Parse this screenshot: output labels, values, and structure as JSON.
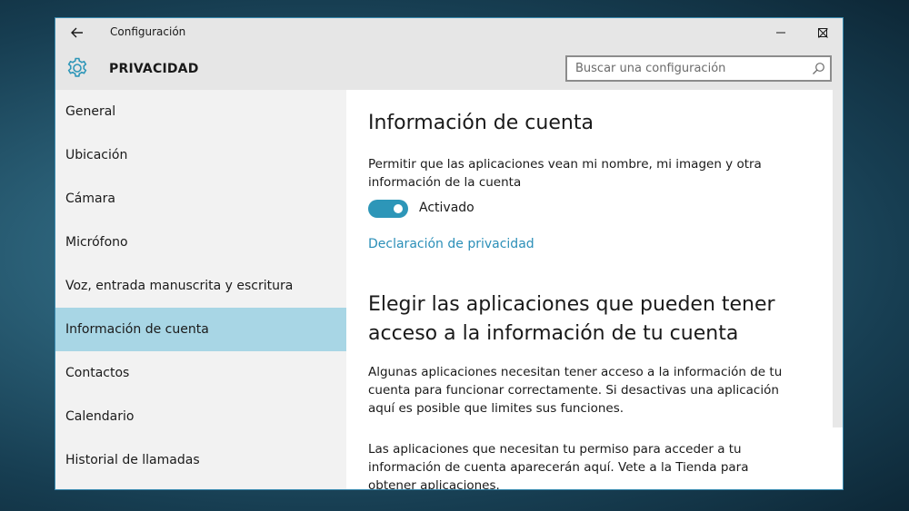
{
  "window": {
    "title": "Configuración"
  },
  "header": {
    "section_title": "PRIVACIDAD",
    "section_icon": "gear-icon",
    "search_placeholder": "Buscar una configuración"
  },
  "sidebar": {
    "items": [
      {
        "label": "General",
        "selected": false
      },
      {
        "label": "Ubicación",
        "selected": false
      },
      {
        "label": "Cámara",
        "selected": false
      },
      {
        "label": "Micrófono",
        "selected": false
      },
      {
        "label": "Voz, entrada manuscrita y escritura",
        "selected": false
      },
      {
        "label": "Información de cuenta",
        "selected": true
      },
      {
        "label": "Contactos",
        "selected": false
      },
      {
        "label": "Calendario",
        "selected": false
      },
      {
        "label": "Historial de llamadas",
        "selected": false
      }
    ]
  },
  "main": {
    "heading": "Información de cuenta",
    "permission_text": "Permitir que las aplicaciones vean mi nombre, mi imagen y otra información de la cuenta",
    "toggle": {
      "state": "on",
      "label": "Activado"
    },
    "privacy_link": "Declaración de privacidad",
    "apps_heading": "Elegir las aplicaciones que pueden tener acceso a la información de tu cuenta",
    "apps_description": "Algunas aplicaciones necesitan tener acceso a la información de tu cuenta para funcionar correctamente. Si desactivas una aplicación aquí es posible que limites sus funciones.",
    "store_text": "Las aplicaciones que necesitan tu permiso para acceder a tu información de cuenta aparecerán aquí. Vete a la Tienda para obtener aplicaciones."
  },
  "colors": {
    "accent": "#2d96b8",
    "link": "#2b8fb8",
    "selected_item": "#a8d6e5",
    "titlebar": "#e6e6e6",
    "sidebar_bg": "#f2f2f2"
  }
}
